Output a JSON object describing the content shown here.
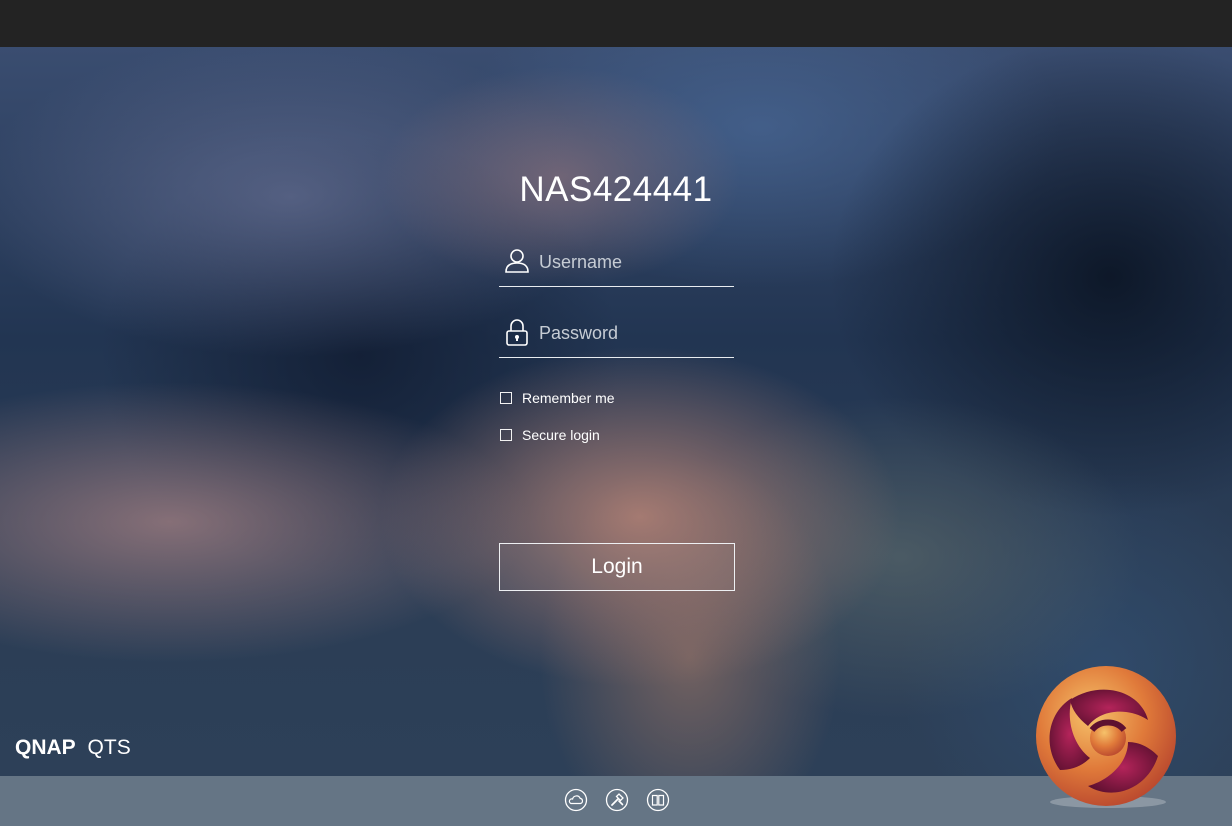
{
  "login": {
    "hostname": "NAS424441",
    "username_placeholder": "Username",
    "password_placeholder": "Password",
    "remember_me_label": "Remember me",
    "secure_login_label": "Secure login",
    "login_button_label": "Login"
  },
  "brand": {
    "name": "QNAP",
    "product": "QTS"
  },
  "footer_icons": [
    "cloud-icon",
    "tools-icon",
    "book-icon"
  ],
  "colors": {
    "top_bar": "#232323",
    "bottom_bar": "#657585",
    "text": "#ffffff"
  }
}
